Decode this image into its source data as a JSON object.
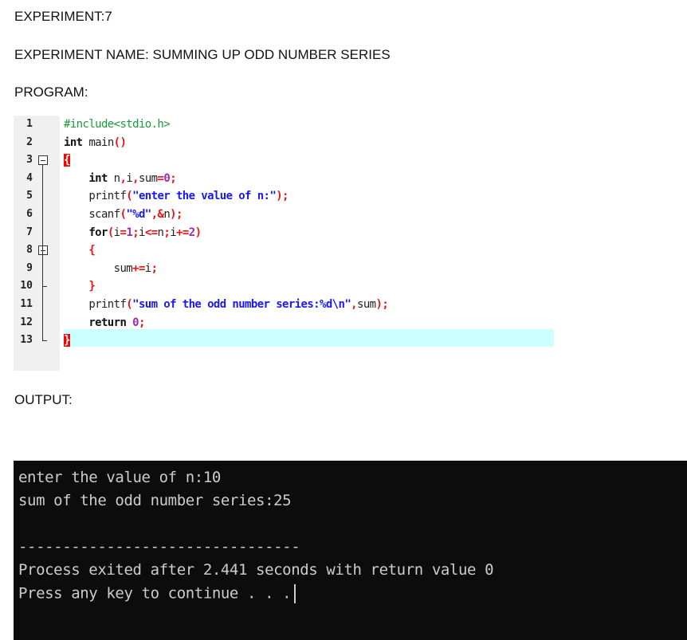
{
  "experiment_label": "EXPERIMENT:7",
  "experiment_name": "EXPERIMENT NAME: SUMMING UP ODD NUMBER SERIES",
  "program_label": "PROGRAM:",
  "output_label": "OUTPUT:",
  "code": {
    "line_numbers": [
      "1",
      "2",
      "3",
      "4",
      "5",
      "6",
      "7",
      "8",
      "9",
      "10",
      "11",
      "12",
      "13"
    ],
    "lines": [
      [
        {
          "t": "#include<stdio.h>",
          "c": "pp"
        }
      ],
      [
        {
          "t": "int ",
          "c": "kw"
        },
        {
          "t": "main",
          "c": "id"
        },
        {
          "t": "()",
          "c": "op"
        }
      ],
      [
        {
          "t": "{",
          "c": "brm"
        }
      ],
      [
        {
          "t": "    int ",
          "c": "kw"
        },
        {
          "t": "n",
          "c": "id"
        },
        {
          "t": ",",
          "c": "op"
        },
        {
          "t": "i",
          "c": "id"
        },
        {
          "t": ",",
          "c": "op"
        },
        {
          "t": "sum",
          "c": "id"
        },
        {
          "t": "=",
          "c": "op"
        },
        {
          "t": "0",
          "c": "num"
        },
        {
          "t": ";",
          "c": "op"
        }
      ],
      [
        {
          "t": "    printf",
          "c": "id"
        },
        {
          "t": "(",
          "c": "op"
        },
        {
          "t": "\"enter the value of n:\"",
          "c": "str"
        },
        {
          "t": ");",
          "c": "op"
        }
      ],
      [
        {
          "t": "    scanf",
          "c": "id"
        },
        {
          "t": "(",
          "c": "op"
        },
        {
          "t": "\"%d\"",
          "c": "str"
        },
        {
          "t": ",&",
          "c": "op"
        },
        {
          "t": "n",
          "c": "id"
        },
        {
          "t": ");",
          "c": "op"
        }
      ],
      [
        {
          "t": "    for",
          "c": "kw"
        },
        {
          "t": "(",
          "c": "op"
        },
        {
          "t": "i",
          "c": "id"
        },
        {
          "t": "=",
          "c": "op"
        },
        {
          "t": "1",
          "c": "num"
        },
        {
          "t": ";",
          "c": "op"
        },
        {
          "t": "i",
          "c": "id"
        },
        {
          "t": "<=",
          "c": "op"
        },
        {
          "t": "n",
          "c": "id"
        },
        {
          "t": ";",
          "c": "op"
        },
        {
          "t": "i",
          "c": "id"
        },
        {
          "t": "+=",
          "c": "op"
        },
        {
          "t": "2",
          "c": "num"
        },
        {
          "t": ")",
          "c": "op"
        }
      ],
      [
        {
          "t": "    {",
          "c": "op"
        }
      ],
      [
        {
          "t": "        sum",
          "c": "id"
        },
        {
          "t": "+=",
          "c": "op"
        },
        {
          "t": "i",
          "c": "id"
        },
        {
          "t": ";",
          "c": "op"
        }
      ],
      [
        {
          "t": "    }",
          "c": "op"
        }
      ],
      [
        {
          "t": "    printf",
          "c": "id"
        },
        {
          "t": "(",
          "c": "op"
        },
        {
          "t": "\"sum of the odd number series:%d\\n\"",
          "c": "str"
        },
        {
          "t": ",",
          "c": "op"
        },
        {
          "t": "sum",
          "c": "id"
        },
        {
          "t": ");",
          "c": "op"
        }
      ],
      [
        {
          "t": "    return ",
          "c": "kw"
        },
        {
          "t": "0",
          "c": "num"
        },
        {
          "t": ";",
          "c": "op"
        }
      ],
      [
        {
          "t": "}",
          "c": "brm"
        }
      ]
    ]
  },
  "terminal": {
    "lines": [
      "enter the value of n:10",
      "sum of the odd number series:25",
      "",
      "--------------------------------",
      "Process exited after 2.441 seconds with return value 0",
      "Press any key to continue . . ."
    ]
  }
}
